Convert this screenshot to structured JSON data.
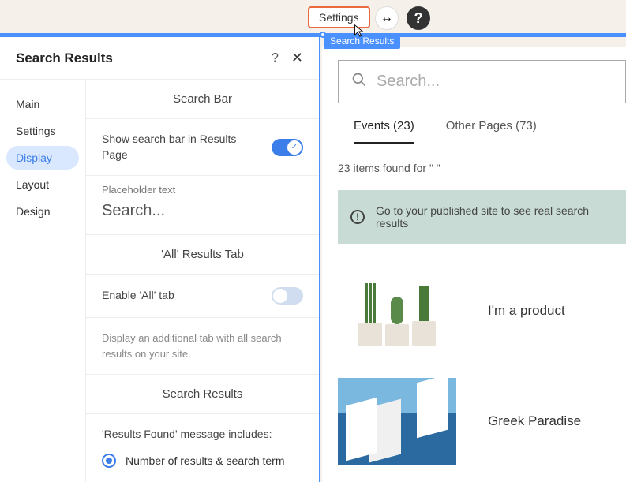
{
  "topbar": {
    "settings_label": "Settings",
    "swap_glyph": "↔",
    "help_glyph": "?"
  },
  "overlay": {
    "sr_label": "Search Results"
  },
  "panel": {
    "title": "Search Results",
    "help_glyph": "?",
    "close_glyph": "✕",
    "nav": [
      "Main",
      "Settings",
      "Display",
      "Layout",
      "Design"
    ],
    "nav_active": 2,
    "sections": {
      "search_bar": {
        "title": "Search Bar",
        "show_label": "Show search bar in Results Page",
        "show_enabled": true,
        "placeholder_label": "Placeholder text",
        "placeholder_value": "Search..."
      },
      "all_tab": {
        "title": "'All' Results Tab",
        "enable_label": "Enable 'All' tab",
        "enable_enabled": false,
        "desc": "Display an additional tab with all search results on your site."
      },
      "search_results": {
        "title": "Search Results",
        "msg_label": "'Results Found' message includes:",
        "radio1": "Number of results & search term"
      }
    }
  },
  "preview": {
    "search_placeholder": "Search...",
    "tabs": [
      {
        "label": "Events (23)",
        "active": true
      },
      {
        "label": "Other Pages (73)",
        "active": false
      }
    ],
    "found_text": "23 items found for \" \"",
    "notice": "Go to your published site to see real search results",
    "results": [
      {
        "title": "I'm a product",
        "thumb": "cactus"
      },
      {
        "title": "Greek Paradise",
        "thumb": "greece"
      }
    ]
  }
}
